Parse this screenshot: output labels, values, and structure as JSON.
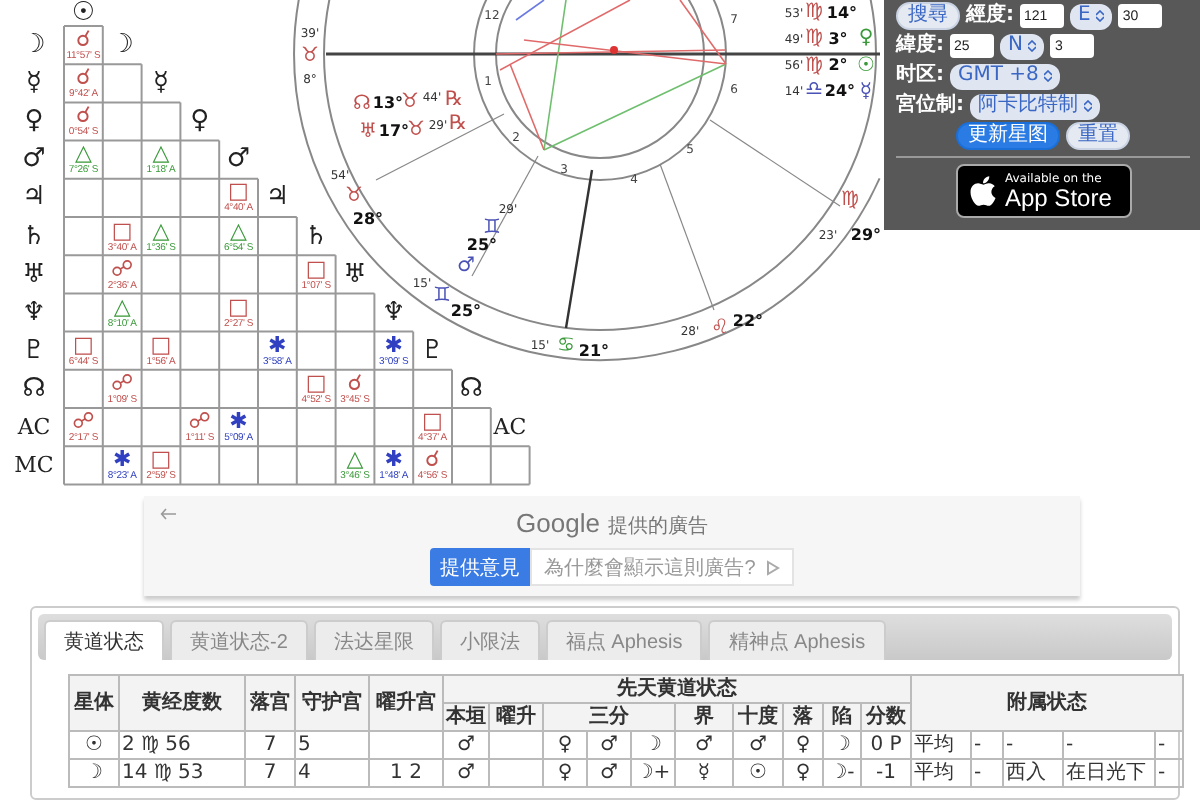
{
  "aspect_grid": {
    "planets": [
      "☉",
      "☽",
      "☿",
      "♀",
      "♂",
      "♃",
      "♄",
      "♅",
      "♆",
      "♇",
      "☊",
      "AC"
    ],
    "rows": [
      {
        "label": "☽",
        "cells": [
          {
            "kind": "conjunction",
            "symbol": "☌",
            "orb": "11°57' S"
          }
        ]
      },
      {
        "label": "☿",
        "cells": [
          {
            "kind": "conjunction",
            "symbol": "☌",
            "orb": "9°42' A"
          },
          {
            "kind": "empty"
          }
        ]
      },
      {
        "label": "♀",
        "cells": [
          {
            "kind": "conjunction",
            "symbol": "☌",
            "orb": "0°54' S"
          },
          {
            "kind": "empty"
          },
          {
            "kind": "empty"
          }
        ]
      },
      {
        "label": "♂",
        "cells": [
          {
            "kind": "trine",
            "symbol": "△",
            "orb": "7°26' S"
          },
          {
            "kind": "empty"
          },
          {
            "kind": "trine",
            "symbol": "△",
            "orb": "1°18' A"
          },
          {
            "kind": "empty"
          }
        ]
      },
      {
        "label": "♃",
        "cells": [
          {
            "kind": "empty"
          },
          {
            "kind": "empty"
          },
          {
            "kind": "empty"
          },
          {
            "kind": "empty"
          },
          {
            "kind": "square",
            "symbol": "□",
            "orb": "4°40' A"
          }
        ]
      },
      {
        "label": "♄",
        "cells": [
          {
            "kind": "empty"
          },
          {
            "kind": "square",
            "symbol": "□",
            "orb": "3°40' A"
          },
          {
            "kind": "trine",
            "symbol": "△",
            "orb": "1°36' S"
          },
          {
            "kind": "empty"
          },
          {
            "kind": "trine",
            "symbol": "△",
            "orb": "6°54' S"
          },
          {
            "kind": "empty"
          }
        ]
      },
      {
        "label": "♅",
        "cells": [
          {
            "kind": "empty"
          },
          {
            "kind": "opposition",
            "symbol": "☍",
            "orb": "2°36' A"
          },
          {
            "kind": "empty"
          },
          {
            "kind": "empty"
          },
          {
            "kind": "empty"
          },
          {
            "kind": "empty"
          },
          {
            "kind": "square",
            "symbol": "□",
            "orb": "1°07' S"
          }
        ]
      },
      {
        "label": "♆",
        "cells": [
          {
            "kind": "empty"
          },
          {
            "kind": "trine",
            "symbol": "△",
            "orb": "8°10' A"
          },
          {
            "kind": "empty"
          },
          {
            "kind": "empty"
          },
          {
            "kind": "square",
            "symbol": "□",
            "orb": "2°27' S"
          },
          {
            "kind": "empty"
          },
          {
            "kind": "empty"
          },
          {
            "kind": "empty"
          }
        ]
      },
      {
        "label": "♇",
        "cells": [
          {
            "kind": "square",
            "symbol": "□",
            "orb": "6°44' S"
          },
          {
            "kind": "empty"
          },
          {
            "kind": "square",
            "symbol": "□",
            "orb": "1°56' A"
          },
          {
            "kind": "empty"
          },
          {
            "kind": "empty"
          },
          {
            "kind": "sextile",
            "symbol": "✱",
            "orb": "3°58' A"
          },
          {
            "kind": "empty"
          },
          {
            "kind": "empty"
          },
          {
            "kind": "sextile",
            "symbol": "✱",
            "orb": "3°09' S"
          }
        ]
      },
      {
        "label": "☊",
        "cells": [
          {
            "kind": "empty"
          },
          {
            "kind": "opposition",
            "symbol": "☍",
            "orb": "1°09' S"
          },
          {
            "kind": "empty"
          },
          {
            "kind": "empty"
          },
          {
            "kind": "empty"
          },
          {
            "kind": "empty"
          },
          {
            "kind": "square",
            "symbol": "□",
            "orb": "4°52' S"
          },
          {
            "kind": "conjunction",
            "symbol": "☌",
            "orb": "3°45' S"
          },
          {
            "kind": "empty"
          },
          {
            "kind": "empty"
          }
        ]
      },
      {
        "label": "AC",
        "cells": [
          {
            "kind": "opposition",
            "symbol": "☍",
            "orb": "2°17' S"
          },
          {
            "kind": "empty"
          },
          {
            "kind": "empty"
          },
          {
            "kind": "opposition",
            "symbol": "☍",
            "orb": "1°11' S"
          },
          {
            "kind": "sextile",
            "symbol": "✱",
            "orb": "5°09' A"
          },
          {
            "kind": "empty"
          },
          {
            "kind": "empty"
          },
          {
            "kind": "empty"
          },
          {
            "kind": "empty"
          },
          {
            "kind": "square",
            "symbol": "□",
            "orb": "4°37' A"
          },
          {
            "kind": "empty"
          }
        ]
      },
      {
        "label": "MC",
        "cells": [
          {
            "kind": "empty"
          },
          {
            "kind": "sextile",
            "symbol": "✱",
            "orb": "8°23' A"
          },
          {
            "kind": "square",
            "symbol": "□",
            "orb": "2°59' S"
          },
          {
            "kind": "empty"
          },
          {
            "kind": "empty"
          },
          {
            "kind": "empty"
          },
          {
            "kind": "empty"
          },
          {
            "kind": "trine",
            "symbol": "△",
            "orb": "3°46' S"
          },
          {
            "kind": "sextile",
            "symbol": "✱",
            "orb": "1°48' A"
          },
          {
            "kind": "conjunction",
            "symbol": "☌",
            "orb": "4°56' S"
          },
          {
            "kind": "empty"
          },
          {
            "kind": "empty"
          }
        ]
      }
    ]
  },
  "wheel": {
    "houses": [
      "12",
      "1",
      "2",
      "3",
      "4",
      "5",
      "6",
      "7"
    ],
    "labels": [
      {
        "kind": "minute",
        "text": "39'"
      },
      {
        "kind": "glyph",
        "text": "♉",
        "color": "#c0504d"
      },
      {
        "kind": "minute",
        "text": "8°"
      },
      {
        "kind": "glyph",
        "text": "☊",
        "color": "#c0504d"
      },
      {
        "kind": "degree",
        "text": "13°"
      },
      {
        "kind": "glyph",
        "text": "♉",
        "color": "#c0504d"
      },
      {
        "kind": "minute",
        "text": "44'"
      },
      {
        "kind": "glyph",
        "text": "℞",
        "color": "#c0504d"
      },
      {
        "kind": "glyph",
        "text": "♅",
        "color": "#c0504d"
      },
      {
        "kind": "degree",
        "text": "17°"
      },
      {
        "kind": "glyph",
        "text": "♉",
        "color": "#c0504d"
      },
      {
        "kind": "minute",
        "text": "29'"
      },
      {
        "kind": "glyph",
        "text": "℞",
        "color": "#c0504d"
      },
      {
        "kind": "minute",
        "text": "54'"
      },
      {
        "kind": "glyph",
        "text": "♉",
        "color": "#c0504d"
      },
      {
        "kind": "degree",
        "text": "28°"
      },
      {
        "kind": "minute",
        "text": "29'"
      },
      {
        "kind": "glyph",
        "text": "♊",
        "color": "#4a52b5"
      },
      {
        "kind": "degree",
        "text": "25°"
      },
      {
        "kind": "glyph",
        "text": "♂",
        "color": "#4a52b5"
      },
      {
        "kind": "minute",
        "text": "15'"
      },
      {
        "kind": "glyph",
        "text": "♊",
        "color": "#4a52b5"
      },
      {
        "kind": "degree",
        "text": "25°"
      },
      {
        "kind": "minute",
        "text": "15'"
      },
      {
        "kind": "glyph",
        "text": "♋",
        "color": "#3a9a3a"
      },
      {
        "kind": "degree",
        "text": "21°"
      },
      {
        "kind": "minute",
        "text": "28'"
      },
      {
        "kind": "glyph",
        "text": "♌",
        "color": "#c0504d"
      },
      {
        "kind": "degree",
        "text": "22°"
      },
      {
        "kind": "degree",
        "text": "29°"
      },
      {
        "kind": "glyph",
        "text": "♍",
        "color": "#c0504d"
      },
      {
        "kind": "minute",
        "text": "23'"
      },
      {
        "kind": "minute",
        "text": "53'"
      },
      {
        "kind": "glyph",
        "text": "♍",
        "color": "#c0504d"
      },
      {
        "kind": "degree",
        "text": "14°"
      },
      {
        "kind": "minute",
        "text": "49'"
      },
      {
        "kind": "glyph",
        "text": "♍",
        "color": "#c0504d"
      },
      {
        "kind": "degree",
        "text": "3°"
      },
      {
        "kind": "glyph",
        "text": "♀",
        "color": "#3a9a3a"
      },
      {
        "kind": "minute",
        "text": "56'"
      },
      {
        "kind": "glyph",
        "text": "♍",
        "color": "#c0504d"
      },
      {
        "kind": "degree",
        "text": "2°"
      },
      {
        "kind": "glyph",
        "text": "☉",
        "color": "#3a9a3a"
      },
      {
        "kind": "minute",
        "text": "14'"
      },
      {
        "kind": "glyph",
        "text": "♎",
        "color": "#4a52b5"
      },
      {
        "kind": "degree",
        "text": "24°"
      },
      {
        "kind": "glyph",
        "text": "☿",
        "color": "#4a52b5"
      }
    ]
  },
  "settings": {
    "rows": [
      {
        "items": [
          {
            "kind": "button",
            "text": "搜尋",
            "primary": false
          },
          {
            "kind": "label",
            "text": "經度:"
          },
          {
            "kind": "input",
            "value": "121"
          },
          {
            "kind": "select",
            "value": "E"
          },
          {
            "kind": "input",
            "value": "30"
          }
        ]
      },
      {
        "items": [
          {
            "kind": "label",
            "text": "緯度:"
          },
          {
            "kind": "input",
            "value": "25"
          },
          {
            "kind": "select",
            "value": "N"
          },
          {
            "kind": "input",
            "value": "3"
          }
        ]
      },
      {
        "items": [
          {
            "kind": "label",
            "text": "时区:"
          },
          {
            "kind": "select",
            "value": "GMT +8"
          }
        ]
      },
      {
        "items": [
          {
            "kind": "label",
            "text": "宮位制:"
          },
          {
            "kind": "select",
            "value": "阿卡比特制"
          }
        ]
      },
      {
        "items": [
          {
            "kind": "button",
            "text": "更新星图",
            "primary": true
          },
          {
            "kind": "button",
            "text": "重置",
            "primary": false
          }
        ]
      }
    ],
    "badge": {
      "small": "Available on the",
      "large": "App Store"
    }
  },
  "ad": {
    "brand": "Google",
    "caption": "提供的廣告",
    "feedback": "提供意見",
    "why": "為什麼會顯示這則廣告?"
  },
  "tabs": [
    {
      "label": "黄道状态",
      "selected": true
    },
    {
      "label": "黄道状态-2",
      "selected": false
    },
    {
      "label": "法达星限",
      "selected": false
    },
    {
      "label": "小限法",
      "selected": false
    },
    {
      "label": "福点 Aphesis",
      "selected": false
    },
    {
      "label": "精神点 Aphesis",
      "selected": false
    }
  ],
  "table": {
    "columns": [
      "星体",
      "黄经度数",
      "落宫",
      "守护宫",
      "曜升宫"
    ],
    "group": "先天黄道状态",
    "subcolumns": [
      "本垣",
      "曜升",
      "三分",
      "界",
      "十度",
      "落",
      "陷",
      "分数"
    ],
    "extra": "附属状态",
    "rows": [
      {
        "planet": "☉",
        "longitude": "2 ♍ 56",
        "house": "7",
        "ruled_house": "5",
        "domicile": "♂",
        "triplicity": [
          "♀",
          "♂",
          "☽"
        ],
        "term": "♂",
        "face": "♂",
        "fall": "♀",
        "detriment": "☽",
        "score": "0 P",
        "attached": [
          "平均",
          "-",
          "-",
          "-",
          "-"
        ]
      },
      {
        "planet": "☽",
        "longitude": "14 ♍ 53",
        "house": "7",
        "ruled_house": "4",
        "exaltation_house": "1 2",
        "domicile": "♂",
        "triplicity": [
          "♀",
          "♂",
          "☽+"
        ],
        "term": "☿",
        "face": "☉",
        "fall": "♀",
        "detriment": "☽-",
        "score": "-1",
        "attached": [
          "平均",
          "-",
          "西入",
          "在日光下",
          "-"
        ]
      }
    ]
  }
}
